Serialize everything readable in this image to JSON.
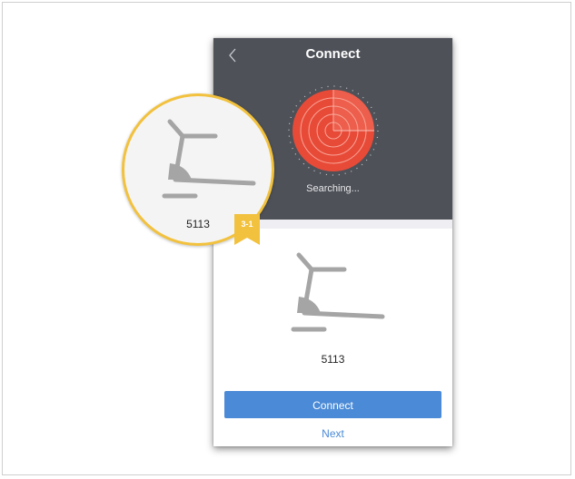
{
  "header": {
    "title": "Connect"
  },
  "radar": {
    "status_text": "Searching..."
  },
  "device": {
    "name": "5113"
  },
  "actions": {
    "connect_label": "Connect",
    "next_label": "Next"
  },
  "callout": {
    "device_name": "5113",
    "step_tag": "3-1"
  },
  "colors": {
    "header_bg": "#4e5158",
    "radar_red": "#e84a38",
    "accent_blue": "#4a8ad6",
    "callout_border": "#f2c13d",
    "icon_gray": "#a5a5a5"
  },
  "icons": {
    "back": "chevron-left-icon",
    "device": "treadmill-icon"
  }
}
